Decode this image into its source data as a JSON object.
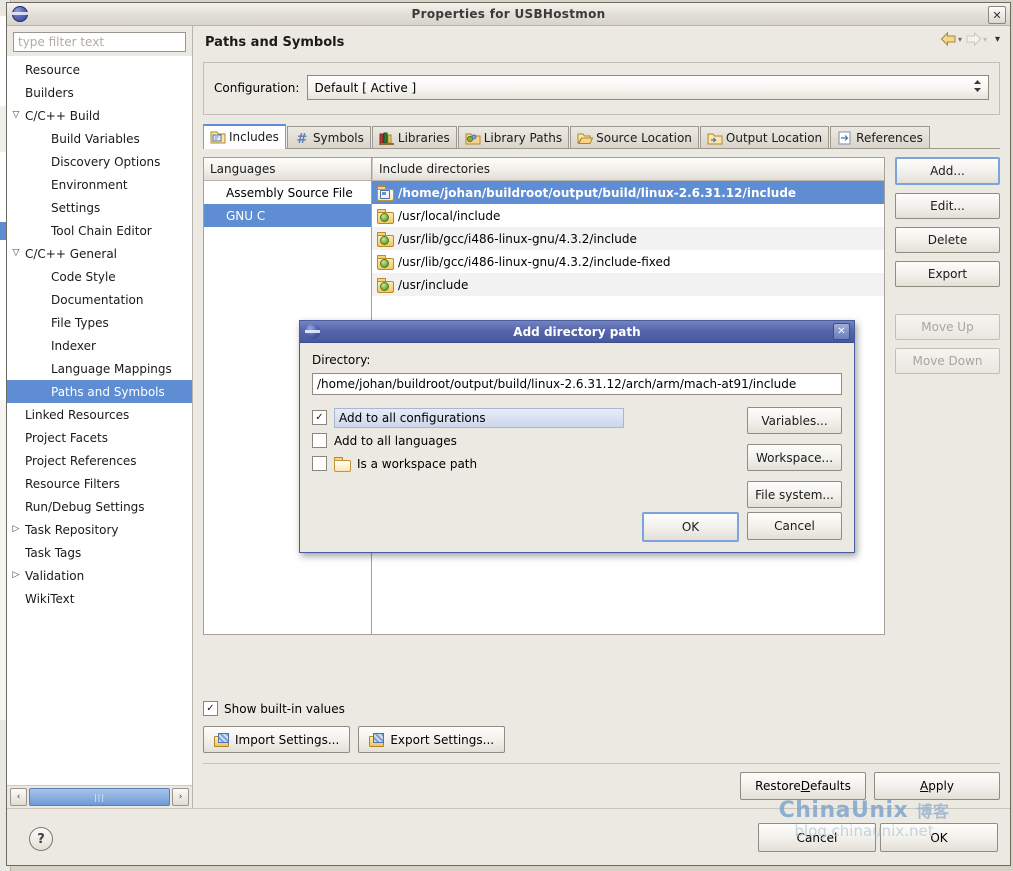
{
  "window": {
    "title": "Properties for USBHostmon",
    "close_label": "✕",
    "app_icon": "eclipse-globe-icon"
  },
  "sidebar": {
    "filter_placeholder": "type filter text",
    "filter_value": "",
    "items": [
      {
        "label": "Resource",
        "depth": 0,
        "twisty": "",
        "selected": false
      },
      {
        "label": "Builders",
        "depth": 0,
        "twisty": "",
        "selected": false
      },
      {
        "label": "C/C++ Build",
        "depth": 0,
        "twisty": "▽",
        "selected": false
      },
      {
        "label": "Build Variables",
        "depth": 1,
        "twisty": "",
        "selected": false
      },
      {
        "label": "Discovery Options",
        "depth": 1,
        "twisty": "",
        "selected": false
      },
      {
        "label": "Environment",
        "depth": 1,
        "twisty": "",
        "selected": false
      },
      {
        "label": "Settings",
        "depth": 1,
        "twisty": "",
        "selected": false
      },
      {
        "label": "Tool Chain Editor",
        "depth": 1,
        "twisty": "",
        "selected": false
      },
      {
        "label": "C/C++ General",
        "depth": 0,
        "twisty": "▽",
        "selected": false
      },
      {
        "label": "Code Style",
        "depth": 1,
        "twisty": "",
        "selected": false
      },
      {
        "label": "Documentation",
        "depth": 1,
        "twisty": "",
        "selected": false
      },
      {
        "label": "File Types",
        "depth": 1,
        "twisty": "",
        "selected": false
      },
      {
        "label": "Indexer",
        "depth": 1,
        "twisty": "",
        "selected": false
      },
      {
        "label": "Language Mappings",
        "depth": 1,
        "twisty": "",
        "selected": false
      },
      {
        "label": "Paths and Symbols",
        "depth": 1,
        "twisty": "",
        "selected": true
      },
      {
        "label": "Linked Resources",
        "depth": 0,
        "twisty": "",
        "selected": false
      },
      {
        "label": "Project Facets",
        "depth": 0,
        "twisty": "",
        "selected": false
      },
      {
        "label": "Project References",
        "depth": 0,
        "twisty": "",
        "selected": false
      },
      {
        "label": "Resource Filters",
        "depth": 0,
        "twisty": "",
        "selected": false
      },
      {
        "label": "Run/Debug Settings",
        "depth": 0,
        "twisty": "",
        "selected": false
      },
      {
        "label": "Task Repository",
        "depth": 0,
        "twisty": "▷",
        "selected": false
      },
      {
        "label": "Task Tags",
        "depth": 0,
        "twisty": "",
        "selected": false
      },
      {
        "label": "Validation",
        "depth": 0,
        "twisty": "▷",
        "selected": false
      },
      {
        "label": "WikiText",
        "depth": 0,
        "twisty": "",
        "selected": false
      }
    ],
    "scroll_left": "‹",
    "scroll_right": "›",
    "scroll_thumb": "|||"
  },
  "header": {
    "page_title": "Paths and Symbols",
    "back_icon": "back-arrow-icon",
    "forward_icon": "forward-arrow-icon",
    "menu_icon": "view-menu-chevron-icon",
    "chevron": "▾"
  },
  "configuration": {
    "label": "Configuration:",
    "value": "Default  [ Active ]"
  },
  "tabs": [
    {
      "label": "Includes",
      "icon": "includes-folder-icon",
      "active": true
    },
    {
      "label": "Symbols",
      "icon": "hash-symbol-icon",
      "active": false
    },
    {
      "label": "Libraries",
      "icon": "books-icon",
      "active": false
    },
    {
      "label": "Library Paths",
      "icon": "library-folder-icon",
      "active": false
    },
    {
      "label": "Source Location",
      "icon": "open-folder-icon",
      "active": false
    },
    {
      "label": "Output Location",
      "icon": "output-folder-icon",
      "active": false
    },
    {
      "label": "References",
      "icon": "references-page-icon",
      "active": false
    }
  ],
  "languages": {
    "header": "Languages",
    "rows": [
      {
        "label": "Assembly Source File",
        "selected": false
      },
      {
        "label": "GNU C",
        "selected": true
      }
    ]
  },
  "includes": {
    "header": "Include directories",
    "rows": [
      {
        "path": "/home/johan/buildroot/output/build/linux-2.6.31.12/include",
        "icon": "kernel-folder-icon",
        "selected": true
      },
      {
        "path": "/usr/local/include",
        "icon": "builtin-folder-icon",
        "selected": false
      },
      {
        "path": "/usr/lib/gcc/i486-linux-gnu/4.3.2/include",
        "icon": "builtin-folder-icon",
        "selected": false
      },
      {
        "path": "/usr/lib/gcc/i486-linux-gnu/4.3.2/include-fixed",
        "icon": "builtin-folder-icon",
        "selected": false
      },
      {
        "path": "/usr/include",
        "icon": "builtin-folder-icon",
        "selected": false
      }
    ]
  },
  "side_buttons": [
    {
      "label": "Add...",
      "state": "focused"
    },
    {
      "label": "Edit...",
      "state": "enabled"
    },
    {
      "label": "Delete",
      "state": "enabled"
    },
    {
      "label": "Export",
      "state": "enabled"
    },
    {
      "label": "Move Up",
      "state": "disabled"
    },
    {
      "label": "Move Down",
      "state": "disabled"
    }
  ],
  "bottom": {
    "show_builtin_label": "Show built-in values",
    "show_builtin_checked": true,
    "check_glyph": "✓",
    "import_settings_label": "Import Settings...",
    "export_settings_label": "Export Settings...",
    "restore_defaults_label_pre": "Restore ",
    "restore_defaults_label_underline": "D",
    "restore_defaults_label_post": "efaults",
    "apply_label_underline": "A",
    "apply_label_post": "pply"
  },
  "footer": {
    "help_label": "?",
    "cancel_label": "Cancel",
    "ok_label": "OK"
  },
  "watermark": {
    "line1_latin": "ChinaUnix",
    "line1_cjk": "博客",
    "line2": "blog.chinaunix.net"
  },
  "modal": {
    "title": "Add directory path",
    "close_label": "✕",
    "directory_label": "Directory:",
    "directory_value": "/home/johan/buildroot/output/build/linux-2.6.31.12/arch/arm/mach-at91/include",
    "options": [
      {
        "label": "Add to all configurations",
        "checked": true,
        "highlight": true,
        "icon": ""
      },
      {
        "label": "Add to all languages",
        "checked": false,
        "highlight": false,
        "icon": ""
      },
      {
        "label": "Is a workspace path",
        "checked": false,
        "highlight": false,
        "icon": "open-folder-icon"
      }
    ],
    "check_glyph": "✓",
    "side_buttons": [
      {
        "label": "Variables..."
      },
      {
        "label": "Workspace..."
      },
      {
        "label": "File system..."
      }
    ],
    "ok_label": "OK",
    "cancel_label": "Cancel"
  }
}
